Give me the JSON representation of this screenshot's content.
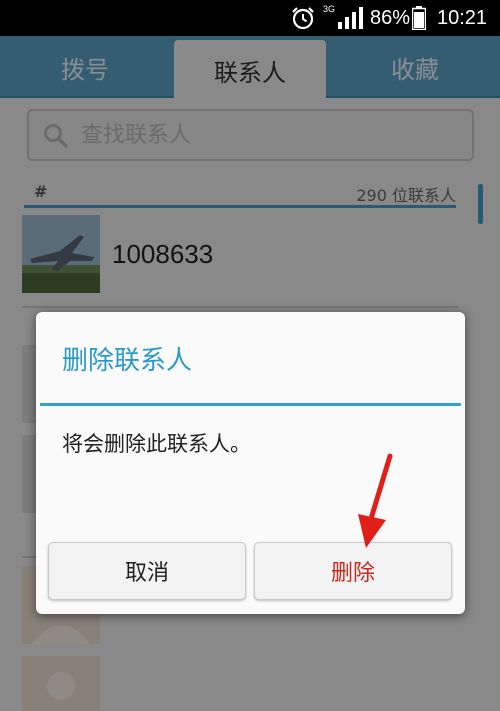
{
  "status_bar": {
    "network": "3G",
    "battery_percent": "86%",
    "time": "10:21",
    "icons": [
      "alarm-icon",
      "signal-icon",
      "battery-icon"
    ]
  },
  "tabs": [
    {
      "label": "拨号"
    },
    {
      "label": "联系人"
    },
    {
      "label": "收藏"
    }
  ],
  "search": {
    "placeholder": "查找联系人"
  },
  "section": {
    "letter": "#",
    "count": "290 位联系人"
  },
  "contacts": [
    {
      "name": "1008633"
    }
  ],
  "dialog": {
    "title": "删除联系人",
    "message": "将会删除此联系人。",
    "cancel_label": "取消",
    "delete_label": "删除"
  },
  "colors": {
    "tab_bar": "#5aa0c4",
    "accent": "#2a9ac8",
    "delete_text": "#c8281e",
    "arrow": "#e02018"
  }
}
